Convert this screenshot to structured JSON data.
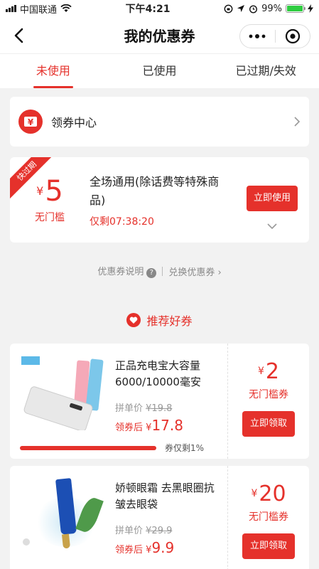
{
  "status": {
    "carrier": "中国联通",
    "time": "下午4:21",
    "battery": "99%",
    "battery_level": 0.99
  },
  "nav": {
    "title": "我的优惠券"
  },
  "tabs": [
    {
      "label": "未使用",
      "active": true
    },
    {
      "label": "已使用",
      "active": false
    },
    {
      "label": "已过期/失效",
      "active": false
    }
  ],
  "coupon_center": {
    "icon_text": "¥",
    "label": "领券中心"
  },
  "coupon": {
    "ribbon": "快过期",
    "currency": "¥",
    "amount": "5",
    "condition": "无门槛",
    "description": "全场通用(除话费等特殊商品)",
    "remaining": "仅剩07:38:20",
    "button": "立即使用"
  },
  "links": {
    "explain": "优惠券说明",
    "explain_icon_text": "?",
    "exchange": "兑换优惠券",
    "exchange_arrow": "›"
  },
  "recommend": {
    "title": "推荐好券"
  },
  "products": [
    {
      "name": "正品充电宝大容量6000/10000毫安",
      "old_price_label": "拼单价",
      "old_price": "¥19.8",
      "after_label": "领券后",
      "after_currency": "¥",
      "after_price": "17.8",
      "coupon_currency": "¥",
      "coupon_amount": "2",
      "coupon_condition": "无门槛券",
      "button": "立即领取",
      "stock_text": "券仅剩1%",
      "stock_fraction": 0.99,
      "image_label": "power-bank"
    },
    {
      "name": "娇顿眼霜 去黑眼圈抗皱去眼袋",
      "old_price_label": "拼单价",
      "old_price": "¥29.9",
      "after_label": "领券后",
      "after_currency": "¥",
      "after_price": "9.9",
      "coupon_currency": "¥",
      "coupon_amount": "20",
      "coupon_condition": "无门槛券",
      "button": "立即领取",
      "image_label": "eye-cream"
    }
  ],
  "colors": {
    "accent": "#e5312b",
    "background": "#f2f2f2"
  }
}
